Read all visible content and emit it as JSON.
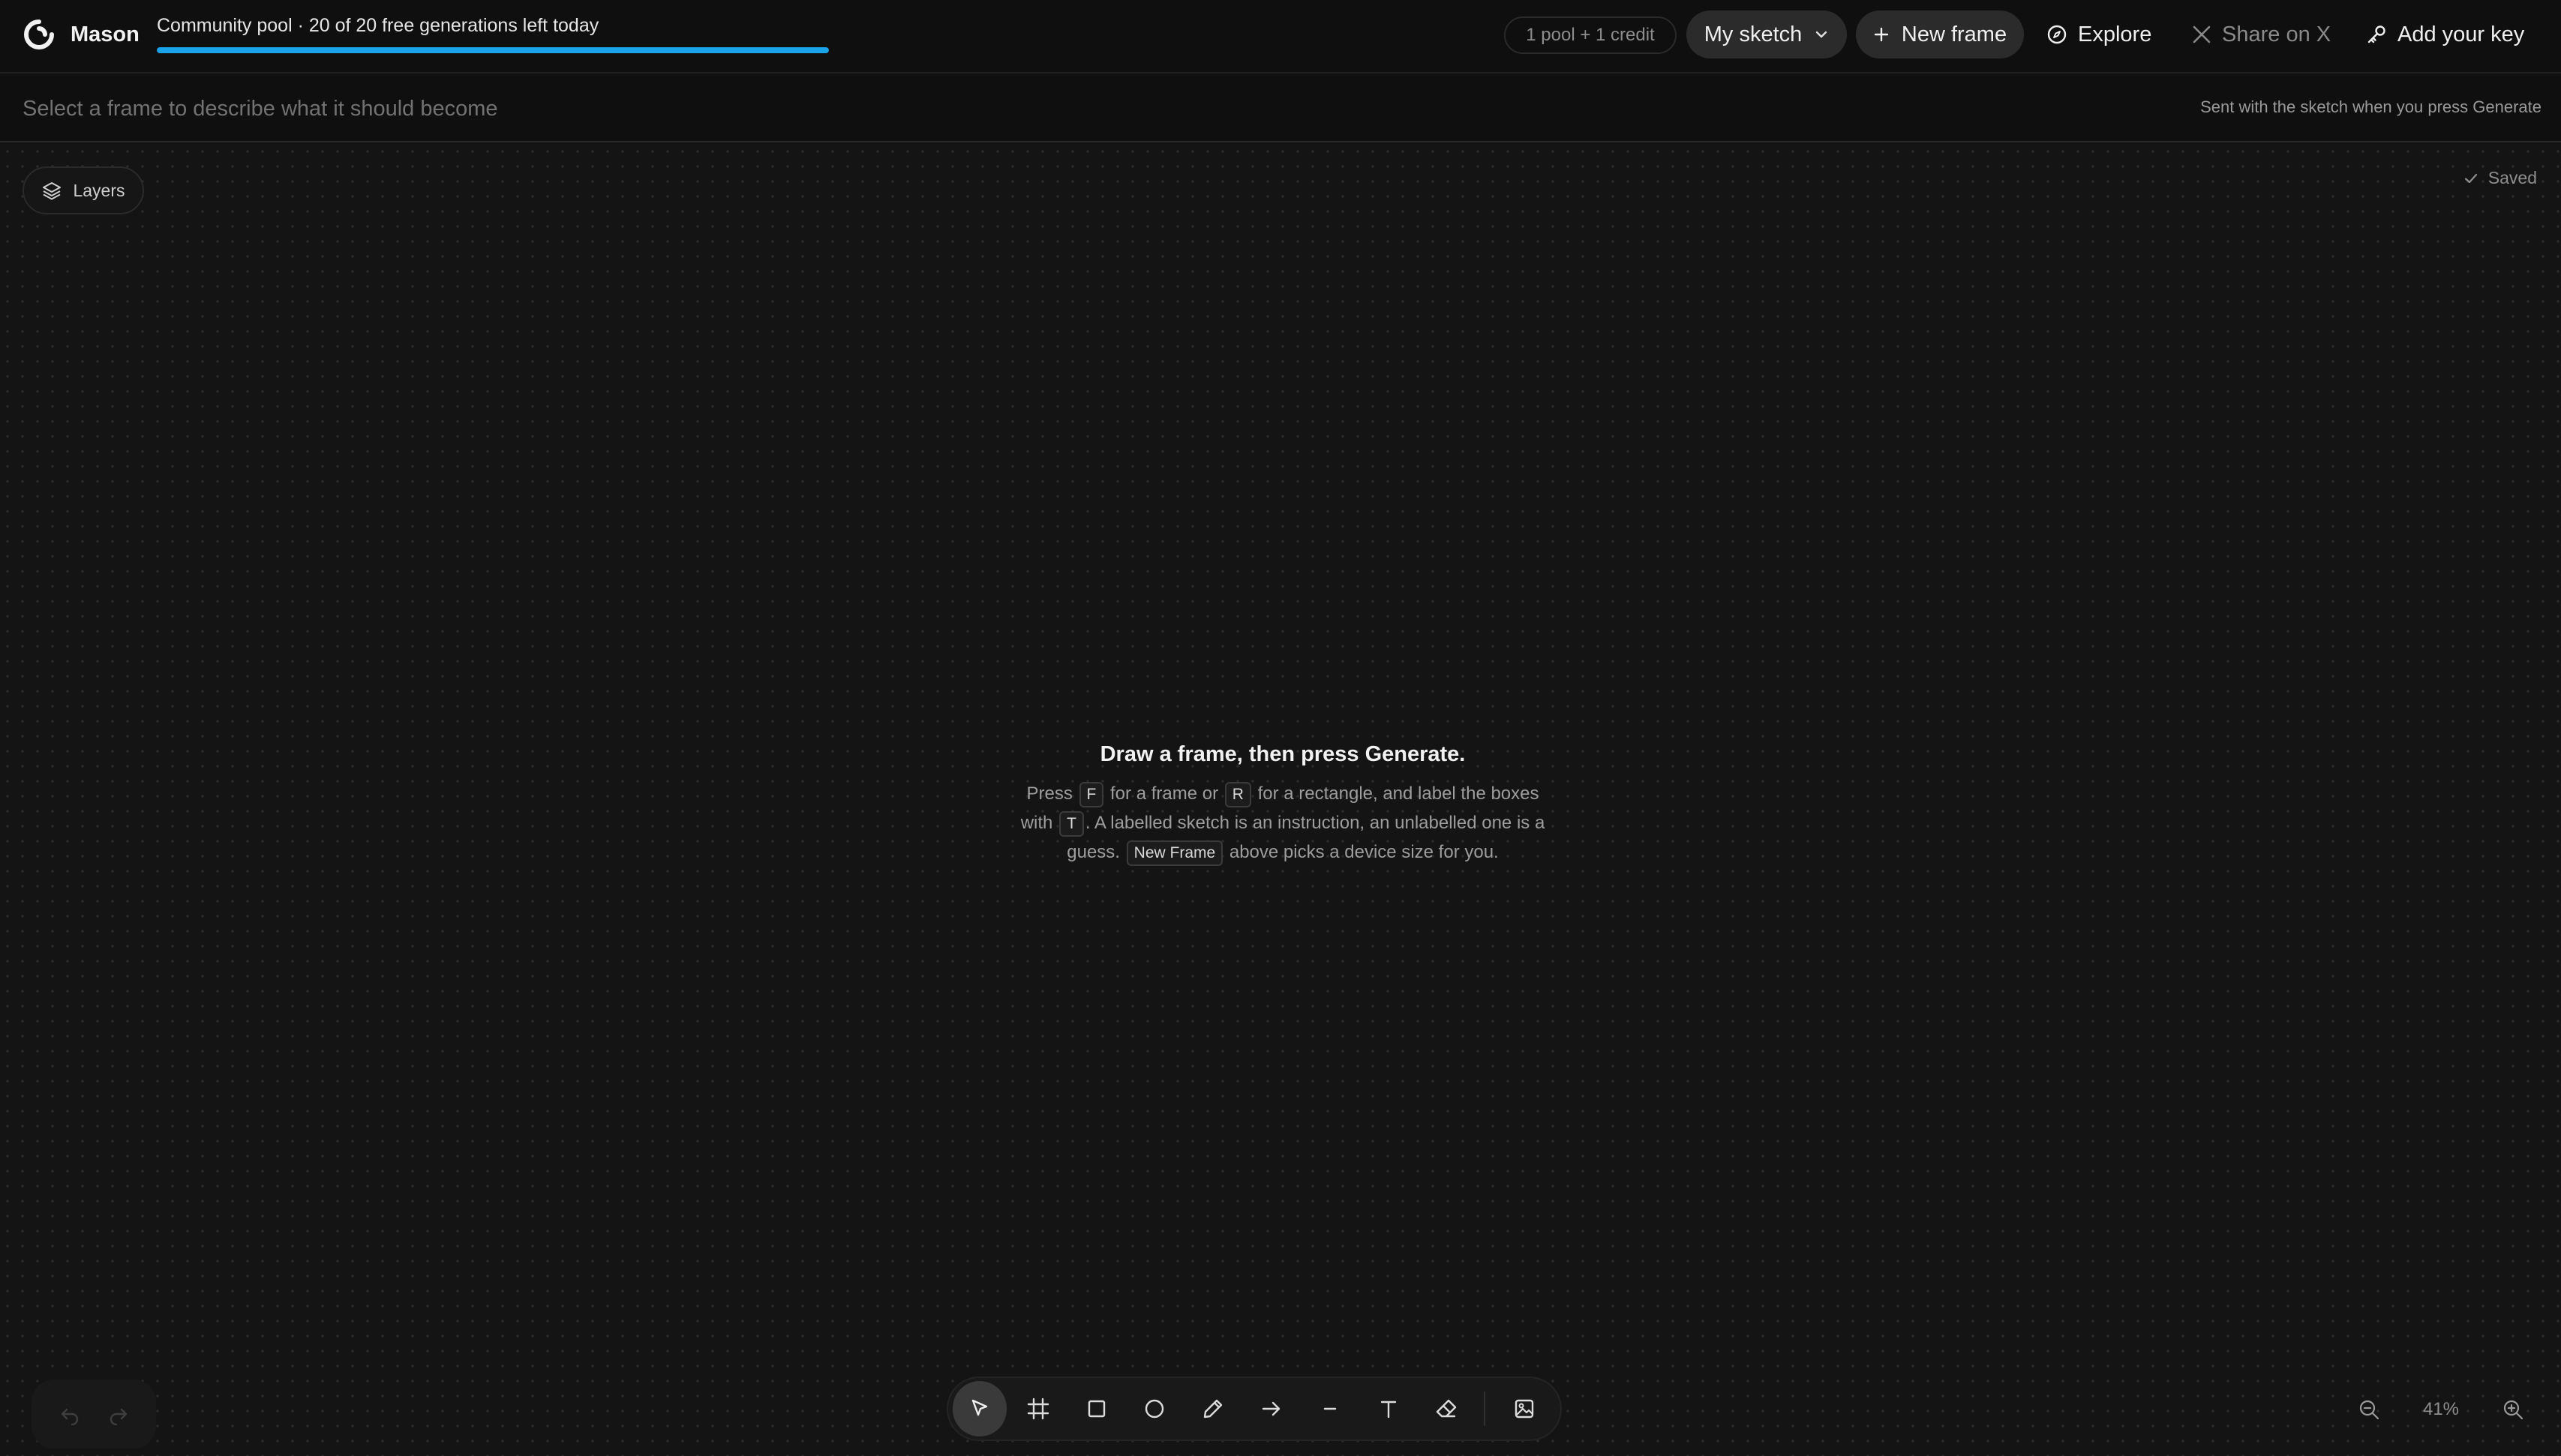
{
  "brand": {
    "name": "Mason"
  },
  "pool": {
    "text": "Community pool · 20 of 20 free generations left today",
    "progress_fraction": 1.0,
    "bar_color": "#1aa3e8"
  },
  "header": {
    "credits": "1 pool + 1 credit",
    "sketch_select": "My sketch",
    "new_frame": "New frame",
    "explore": "Explore",
    "share": "Share on X",
    "add_key": "Add your key"
  },
  "describe": {
    "placeholder": "Select a frame to describe what it should become",
    "hint": "Sent with the sketch when you press Generate"
  },
  "canvas": {
    "layers_label": "Layers",
    "saved_label": "Saved"
  },
  "empty_state": {
    "title": "Draw a frame, then press Generate.",
    "press": "Press",
    "key_f": "F",
    "for_frame_or": "for a frame or",
    "key_r": "R",
    "for_rectangle": "for a rectangle, and label the boxes",
    "with": "with",
    "key_t": "T",
    "labelled_text": ". A labelled sketch is an instruction, an unlabelled one is a",
    "guess": "guess.",
    "new_frame_key": "New Frame",
    "above_text": "above picks a device size for you."
  },
  "toolbar": {
    "tools": [
      "select-tool",
      "frame-tool",
      "rectangle-tool",
      "ellipse-tool",
      "pencil-tool",
      "arrow-tool",
      "line-tool",
      "text-tool",
      "eraser-tool",
      "image-tool"
    ],
    "active_tool": "select-tool"
  },
  "zoom": {
    "value": "41%"
  },
  "colors": {
    "background": "#111111",
    "accent": "#1aa3e8",
    "pill": "#2b2b2b"
  }
}
